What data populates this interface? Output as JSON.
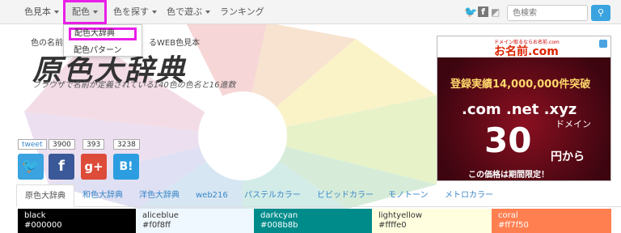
{
  "navbar": {
    "items": [
      {
        "label": "色見本",
        "caret": true
      },
      {
        "label": "配色",
        "caret": true
      },
      {
        "label": "色を探す",
        "caret": true
      },
      {
        "label": "色で遊ぶ",
        "caret": true
      },
      {
        "label": "ランキング",
        "caret": false
      }
    ],
    "search_placeholder": "色検索",
    "search_icon": "search-icon",
    "social_icons": [
      "twitter-icon",
      "facebook-icon",
      "rss-icon"
    ]
  },
  "dropdown": {
    "items": [
      "配色大辞典",
      "配色パターン"
    ]
  },
  "hero": {
    "tagline": "色の名前と",
    "tagline_end": "るWEB色見本",
    "logo": "原色大辞典",
    "subtitle": "ブラウザで名前が定義されている140色の色名と16進数"
  },
  "share": {
    "counts": [
      "tweet",
      "3900",
      "393",
      "3238"
    ],
    "buttons": [
      {
        "icon": "twitter-icon",
        "glyph": "🐦",
        "color": "#3aa3e0"
      },
      {
        "icon": "facebook-icon",
        "glyph": "f",
        "color": "#3b5998"
      },
      {
        "icon": "googleplus-icon",
        "glyph": "g+",
        "color": "#dd4b39"
      },
      {
        "icon": "hatena-icon",
        "glyph": "B!",
        "color": "#2c9de0"
      }
    ]
  },
  "ad": {
    "brand_sub": "ドメイン取るならお名前.com",
    "brand": "お名前.com",
    "count": "登録実績14,000,000件突破",
    "tlds": ".com .net .xyz",
    "domain_label": "ドメイン",
    "price": "30",
    "yen": "円から",
    "notice": "この価格は期間限定！"
  },
  "tabs": [
    "原色大辞典",
    "和色大辞典",
    "洋色大辞典",
    "web216",
    "パステルカラー",
    "ビビッドカラー",
    "モノトーン",
    "メトロカラー"
  ],
  "swatches": [
    {
      "name": "black",
      "hex": "#000000",
      "bg": "#000000",
      "fg": "#ffffff"
    },
    {
      "name": "aliceblue",
      "hex": "#f0f8ff",
      "bg": "#f0f8ff",
      "fg": "#333333"
    },
    {
      "name": "darkcyan",
      "hex": "#008b8b",
      "bg": "#008b8b",
      "fg": "#ffffff"
    },
    {
      "name": "lightyellow",
      "hex": "#ffffe0",
      "bg": "#ffffe0",
      "fg": "#333333"
    },
    {
      "name": "coral",
      "hex": "#ff7f50",
      "bg": "#ff7f50",
      "fg": "#ffffff"
    }
  ],
  "colors": {
    "highlight": "#e91ee8",
    "accent": "#3aa3e0",
    "link": "#3a86c8"
  }
}
